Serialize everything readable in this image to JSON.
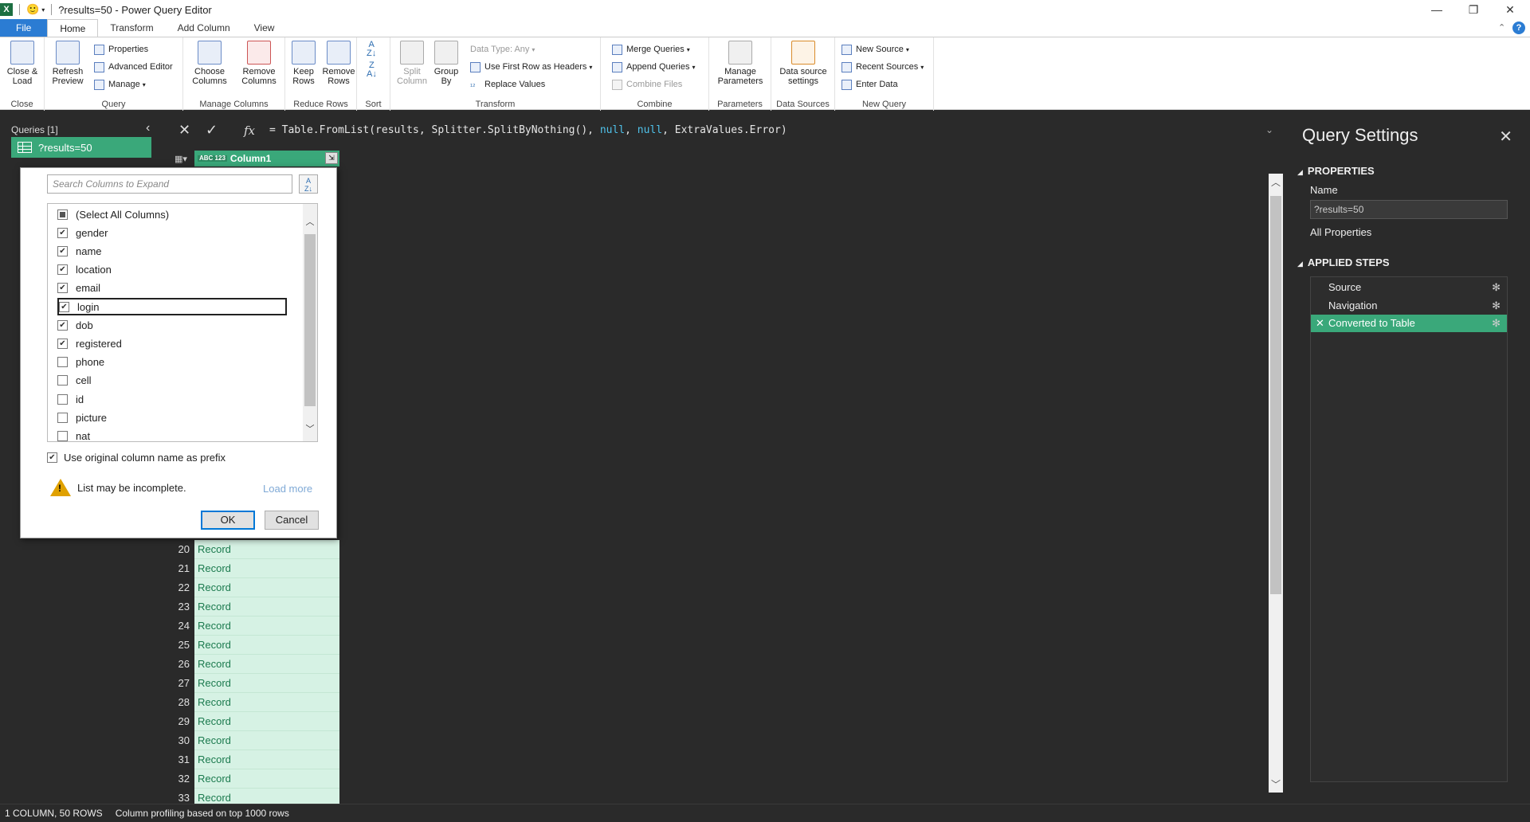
{
  "title_bar": {
    "title": "?results=50 - Power Query Editor",
    "app_icon": "X",
    "smiley": "🙂",
    "minimize": "—",
    "restore": "❐",
    "close": "✕"
  },
  "tabs": [
    "File",
    "Home",
    "Transform",
    "Add Column",
    "View"
  ],
  "ribbon": {
    "close_group": {
      "label": "Close",
      "close_load": "Close & Load"
    },
    "query_group": {
      "label": "Query",
      "refresh": "Refresh Preview",
      "properties": "Properties",
      "advanced_editor": "Advanced Editor",
      "manage": "Manage"
    },
    "manage_columns": {
      "label": "Manage Columns",
      "choose": "Choose Columns",
      "remove": "Remove Columns"
    },
    "reduce_rows": {
      "label": "Reduce Rows",
      "keep": "Keep Rows",
      "remove": "Remove Rows"
    },
    "sort": {
      "label": "Sort"
    },
    "transform": {
      "label": "Transform",
      "split": "Split Column",
      "group": "Group By",
      "data_type": "Data Type: Any",
      "first_row": "Use First Row as Headers",
      "replace": "Replace Values"
    },
    "combine": {
      "label": "Combine",
      "merge": "Merge Queries",
      "append": "Append Queries",
      "combine_files": "Combine Files"
    },
    "parameters": {
      "label": "Parameters",
      "manage": "Manage Parameters"
    },
    "data_sources": {
      "label": "Data Sources",
      "settings": "Data source settings"
    },
    "new_query": {
      "label": "New Query",
      "new_source": "New Source",
      "recent": "Recent Sources",
      "enter_data": "Enter Data"
    }
  },
  "queries": {
    "header": "Queries [1]",
    "items": [
      "?results=50"
    ]
  },
  "formula": {
    "prefix": "= Table.FromList(results, Splitter.SplitByNothing(), ",
    "null1": "null",
    "sep1": ", ",
    "null2": "null",
    "suffix": ", ExtraValues.Error)"
  },
  "grid": {
    "column": "Column1",
    "type_badge": "ABC 123",
    "rows": [
      {
        "n": "20",
        "v": "Record"
      },
      {
        "n": "21",
        "v": "Record"
      },
      {
        "n": "22",
        "v": "Record"
      },
      {
        "n": "23",
        "v": "Record"
      },
      {
        "n": "24",
        "v": "Record"
      },
      {
        "n": "25",
        "v": "Record"
      },
      {
        "n": "26",
        "v": "Record"
      },
      {
        "n": "27",
        "v": "Record"
      },
      {
        "n": "28",
        "v": "Record"
      },
      {
        "n": "29",
        "v": "Record"
      },
      {
        "n": "30",
        "v": "Record"
      },
      {
        "n": "31",
        "v": "Record"
      },
      {
        "n": "32",
        "v": "Record"
      },
      {
        "n": "33",
        "v": "Record"
      }
    ]
  },
  "expand_dialog": {
    "search_placeholder": "Search Columns to Expand",
    "items": [
      {
        "label": "(Select All Columns)",
        "state": "partial"
      },
      {
        "label": "gender",
        "state": "checked"
      },
      {
        "label": "name",
        "state": "checked"
      },
      {
        "label": "location",
        "state": "checked"
      },
      {
        "label": "email",
        "state": "checked"
      },
      {
        "label": "login",
        "state": "checked"
      },
      {
        "label": "dob",
        "state": "checked"
      },
      {
        "label": "registered",
        "state": "checked"
      },
      {
        "label": "phone",
        "state": "unchecked"
      },
      {
        "label": "cell",
        "state": "unchecked"
      },
      {
        "label": "id",
        "state": "unchecked"
      },
      {
        "label": "picture",
        "state": "unchecked"
      },
      {
        "label": "nat",
        "state": "unchecked"
      }
    ],
    "prefix_label": "Use original column name as prefix",
    "warning": "List may be incomplete.",
    "load_more": "Load more",
    "ok": "OK",
    "cancel": "Cancel"
  },
  "query_settings": {
    "title": "Query Settings",
    "properties": "PROPERTIES",
    "name_label": "Name",
    "name_value": "?results=50",
    "all_properties": "All Properties",
    "applied_steps": "APPLIED STEPS",
    "steps": [
      "Source",
      "Navigation",
      "Converted to Table"
    ]
  },
  "status": {
    "columns_rows": "1 COLUMN, 50 ROWS",
    "profiling": "Column profiling based on top 1000 rows"
  },
  "colors": {
    "accent_green": "#3aa87a",
    "file_tab_blue": "#2b7cd3",
    "background_dark": "#2a2a2a"
  }
}
